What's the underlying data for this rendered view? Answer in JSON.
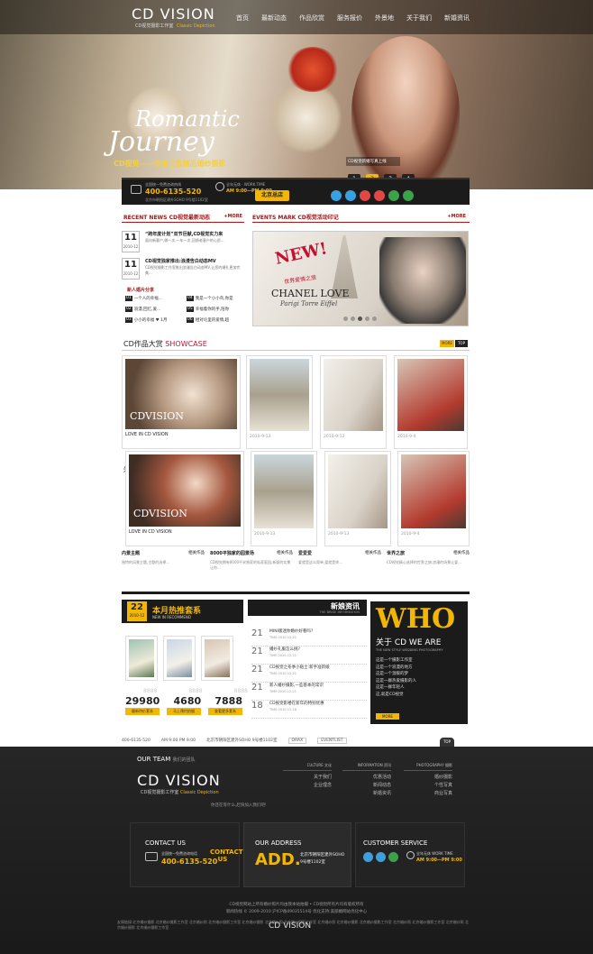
{
  "header": {
    "logo": "CD VISION",
    "tagline_cn": "CD视觉摄影工作室",
    "tagline_en": "Classic Depiction",
    "nav": [
      "首页",
      "最新动态",
      "作品欣赏",
      "服务报价",
      "外景地",
      "关于我们",
      "新婚资讯"
    ]
  },
  "hero": {
    "title_line1": "Romantic",
    "title_line2": "Journey",
    "caption": "CD视觉——浪漫之旅精品婚纱摄影",
    "overlay_text": "CD视觉新婚写真上线",
    "pager": [
      "1",
      "2",
      "3",
      "4"
    ],
    "active_page": "2"
  },
  "infobar": {
    "hotline_label": "全国统一免费咨询热线",
    "hotline": "400-6135-520",
    "address": "北京市朝阳区建外SOHO 9号楼1102室",
    "work_label": "全年无休",
    "work_time": "AM 9:00—PM 9:00",
    "worktime_word": "WORK TIME",
    "hq_button": "北京总店"
  },
  "recent_news": {
    "title": "RECENT NEWS CD视觉最新动态",
    "more": "+MORE",
    "items": [
      {
        "day": "11",
        "ym": "2010-12",
        "title": "“跨年度计划”双节巨献,CD视觉实力来",
        "desc": "面向新客户,做一次,一年一次,回馈老客户的心愿..."
      },
      {
        "day": "11",
        "ym": "2010-12",
        "title": "CD视觉独家推出:浪漫告白动态MV",
        "desc": "CD视觉摄影工作室推出浪漫告白动态MV,让您的婚礼更加完美..."
      }
    ],
    "share_title": "新人婚片分享",
    "share_items": [
      {
        "n": "01",
        "t": "一个人的幸福..."
      },
      {
        "n": "02",
        "t": "浪漫,回忆,爱..."
      },
      {
        "n": "03",
        "t": "小小的幸福 ♥ 1月"
      },
      {
        "n": "04",
        "t": "我是一个小小鸟,你是"
      },
      {
        "n": "05",
        "t": "幸福着你的手,陪你"
      },
      {
        "n": "06",
        "t": "相对论里的爱情,超"
      }
    ]
  },
  "events": {
    "title": "EVENTS MARK CD视觉活动印记",
    "more": "+MORE",
    "new_badge": "NEW!",
    "slogan": "世界爱情之旅",
    "brand": "CHANEL LOVE",
    "place": "Parigi Torre Eiffel",
    "dots": [
      "1",
      "2",
      "3",
      "4",
      "5"
    ]
  },
  "showcase": {
    "title_cn": "CD作品大赏",
    "title_en": "SHOWCASE",
    "btn_more": "MORE",
    "btn_top": "TOP",
    "row1": [
      {
        "label": "LOVE IN CD VISION",
        "date": ""
      },
      {
        "label": "",
        "date": "2010-9-13"
      },
      {
        "label": "",
        "date": "2010-9-13"
      },
      {
        "label": "",
        "date": "2010-9-4"
      }
    ],
    "row2": [
      {
        "label": "LOVE IN CD VISION",
        "date": ""
      },
      {
        "label": "",
        "date": "2010-9-13"
      },
      {
        "label": "",
        "date": "2010-9-13"
      },
      {
        "label": "",
        "date": "2010-9-4"
      }
    ],
    "side_label": "外",
    "watermark": "CDVISION"
  },
  "categories": [
    {
      "title": "内景主题",
      "link": "相关作品",
      "desc": "独特的风景主题,主题的选择..."
    },
    {
      "title": "8000平独家的园景场",
      "link": "相关作品",
      "desc": "CD视觉拥有8000平米独家的私家庭园,新颖的实景让你..."
    },
    {
      "title": "爱爱爱",
      "link": "相关作品",
      "desc": "爱就是这么简单,爱就是你..."
    },
    {
      "title": "世界之旅",
      "link": "相关作品",
      "desc": "CD视觉精心选择的世界之旅,浪漫的场景让爱..."
    }
  ],
  "promo": {
    "day": "22",
    "ym": "2010-12",
    "title": "本月热推套系",
    "subtitle": "NEW IN RECOMMEND",
    "prices": [
      "29980",
      "4680",
      "7888"
    ],
    "price_labels": [
      "8888",
      "8888",
      "8888"
    ],
    "buttons": [
      "最新特价套系",
      "马上预约拍摄",
      "查看更多套系"
    ]
  },
  "bride_news": {
    "title": "新娘资讯",
    "subtitle": "THE BRIDE INFORMATION",
    "items": [
      {
        "d": "21",
        "t": "MINI版迷你婚纱好看吗?",
        "time": "TIME:2010-12-21"
      },
      {
        "d": "21",
        "t": "婚纱礼服怎么挑?",
        "time": "TIME:2010-12-21"
      },
      {
        "d": "21",
        "t": "CD视觉之冬季小贴士:新手准新娘",
        "time": "TIME:2010-12-21"
      },
      {
        "d": "21",
        "t": "新人婚纱摄影,一些基本的常识",
        "time": "TIME:2010-12-21"
      },
      {
        "d": "18",
        "t": "CD视觉影楼在新年的特别优惠",
        "time": "TIME:2010-12-18"
      }
    ]
  },
  "who": {
    "big": "WHO",
    "line": "关于 CD WE ARE",
    "sub": "THE NEW STYLE WEDDING PHOTOGRAPHY",
    "lines": [
      "这是一个摄影工作室",
      "这是一个浪漫的地方",
      "这是一个温暖的梦",
      "这是一群热爱摄影的人",
      "这是一群年轻人",
      "这,就是CD视觉"
    ],
    "more": "MORE"
  },
  "bottom_info": {
    "hotline": "400-6135-520",
    "work": "AM 9:00 PM 9:00",
    "address": "北京市朝阳区建外SOHO 9号楼1102室",
    "links": [
      "ORAX",
      "EVENTLIST"
    ],
    "top": "TOP"
  },
  "team": {
    "label": "OUR TEAM",
    "label_cn": "我们的团队",
    "logo": "CD VISION",
    "tagline_cn": "CD视觉摄影工作室",
    "tagline_en": "Classic Depiction",
    "slogan": "你还在等什么,赶快加入我们吧!",
    "culture": {
      "title": "CULTURE 文化",
      "items": [
        "关于我们",
        "企业理念"
      ]
    },
    "info": {
      "title": "INFORMATION 资讯",
      "items": [
        "优惠活动",
        "新闻动态",
        "新婚资讯"
      ]
    },
    "photo": {
      "title": "PHOTOGRAPHY 摄影",
      "items": [
        "婚纱摄影",
        "个性写真",
        "商业写真"
      ]
    }
  },
  "contact": {
    "title": "CONTACT US",
    "line": "全国统一免费咨询电话",
    "hotline": "400-6135-520",
    "badge": "CONTACT US"
  },
  "address_box": {
    "title": "OUR ADDRESS",
    "big": "ADD.",
    "line1": "北京市朝阳区建外SOHO",
    "line2": "9号楼1102室"
  },
  "service": {
    "title": "CUSTOMER SERVICE",
    "work_label": "全年无休",
    "work": "WORK TIME",
    "hours": "AM 9:00—PM 9:00"
  },
  "footer": {
    "copy1": "CD视觉网站上所有婚纱照片均由我本站拍摄 • CD视觉所有片均有版权所有",
    "copy2": "新闻热线 © 2009-2010 沪ICP备09035514号 优化支持:美丽婚网站优化中心",
    "keywords": "友情链接:北京婚纱摄影 北京婚纱摄影工作室 北京婚纱照 北京婚纱摄影工作室 北京婚纱摄影 北京婚纱照 北京婚纱摄影工作室 北京婚纱照 北京婚纱摄影 北京婚纱摄影工作室 北京婚纱照 北京婚纱摄影工作室 北京婚纱照 北京婚纱摄影 北京婚纱摄影工作室",
    "logo": "CD VISION"
  }
}
